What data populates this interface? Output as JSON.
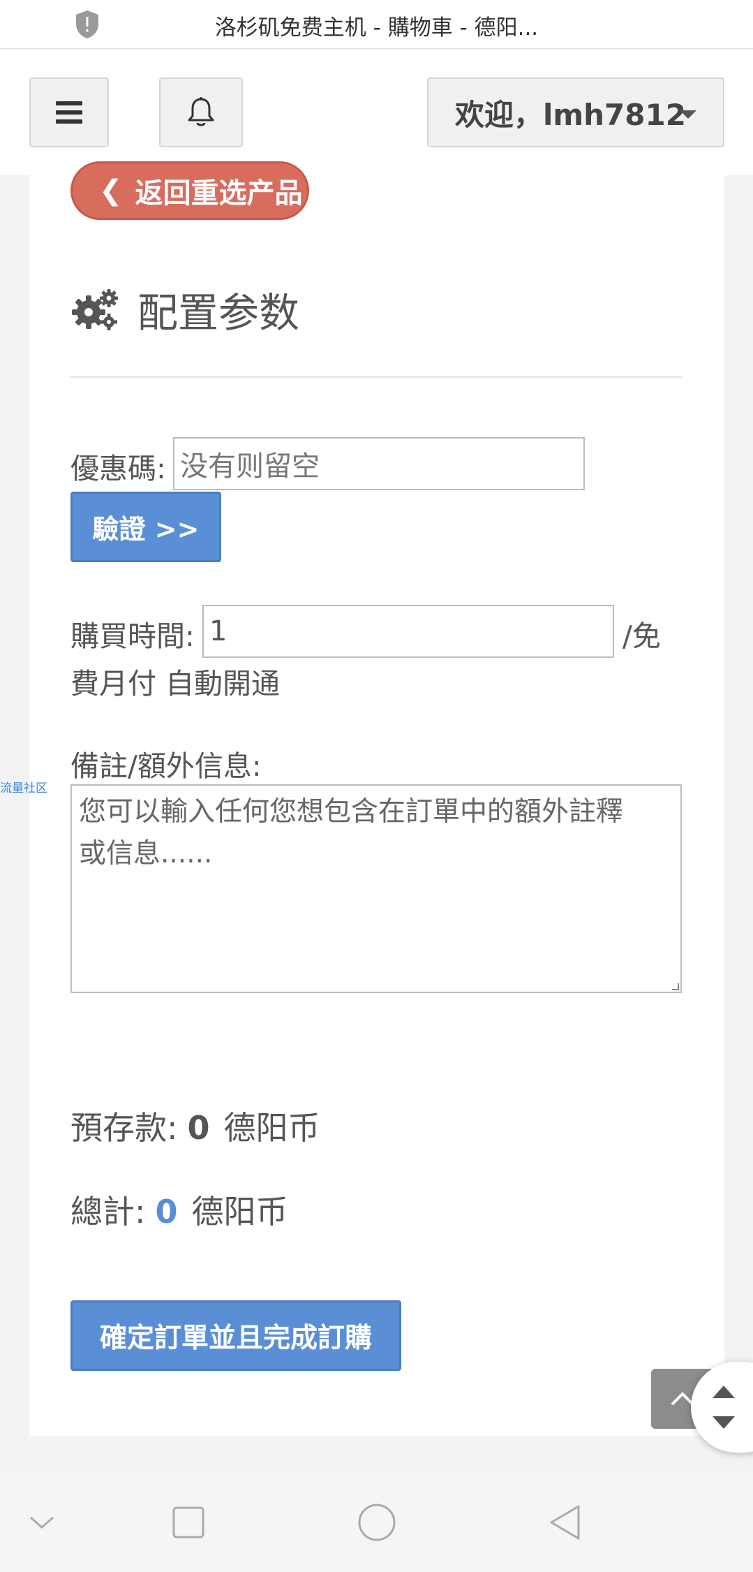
{
  "browser": {
    "title": "洛杉矶免费主机 - 購物車 - 德阳..."
  },
  "nav": {
    "user_greeting": "欢迎，lmh7812"
  },
  "back_button_label": "返回重选产品",
  "section_title": "配置参数",
  "coupon": {
    "label": "優惠碼:",
    "placeholder": "没有则留空",
    "verify_label": "驗證 >>"
  },
  "purchase_time": {
    "label": "購買時間:",
    "value": "1",
    "suffix_1": "/免",
    "suffix_2": "費月付 自動開通"
  },
  "notes": {
    "label": "備註/額外信息:",
    "placeholder_line1": "您可以輸入任何您想包含在訂單中的額外註釋",
    "placeholder_line2": "或信息......"
  },
  "side_link": "流量社区",
  "deposit": {
    "label": "預存款:",
    "amount": "0",
    "unit": "德阳币"
  },
  "total": {
    "label": "總計:",
    "amount": "0",
    "unit": "德阳币"
  },
  "confirm_label": "確定訂單並且完成訂購",
  "colors": {
    "primary": "#5a8fd6",
    "danger": "#d86c5d"
  }
}
